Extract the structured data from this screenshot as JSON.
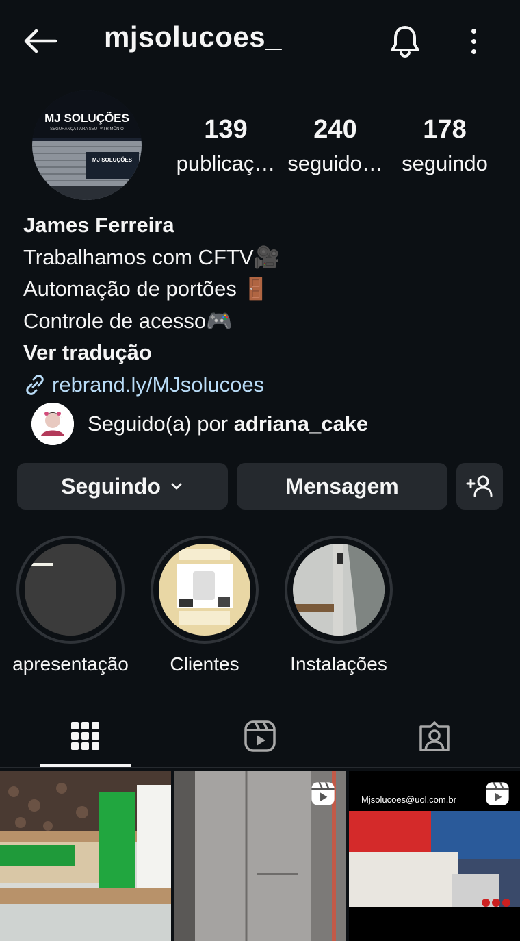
{
  "header": {
    "username": "mjsolucoes_",
    "back_icon": "arrow-left-icon",
    "bell_icon": "bell-icon",
    "more_icon": "more-vertical-icon"
  },
  "profile": {
    "avatar_text_line1": "MJ SOLUÇÕES",
    "avatar_text_line2": "SEGURANÇA PARA SEU PATRIMÔNIO",
    "stats": [
      {
        "number": "139",
        "label": "publicaç…"
      },
      {
        "number": "240",
        "label": "seguido…"
      },
      {
        "number": "178",
        "label": "seguindo"
      }
    ],
    "name": "James Ferreira",
    "bio_lines": [
      "Trabalhamos com CFTV🎥",
      "Automação de portões 🚪",
      "Controle de acesso🎮"
    ],
    "translate_label": "Ver tradução",
    "link": "rebrand.ly/MJsolucoes",
    "followed_by_prefix": "Seguido(a) por ",
    "followed_by_user": "adriana_cake"
  },
  "actions": {
    "following_label": "Seguindo",
    "message_label": "Mensagem"
  },
  "highlights": [
    {
      "label": "apresentação"
    },
    {
      "label": "Clientes"
    },
    {
      "label": "Instalações"
    }
  ],
  "tabs": [
    {
      "name": "grid-icon"
    },
    {
      "name": "reels-icon"
    },
    {
      "name": "tagged-icon"
    }
  ],
  "posts": [
    {
      "caption": ""
    },
    {
      "caption": ""
    },
    {
      "caption": "Mjsolucoes@uol.com.br"
    }
  ],
  "colors": {
    "background": "#0c1014",
    "button": "#25292e",
    "link": "#b9dcf7"
  }
}
